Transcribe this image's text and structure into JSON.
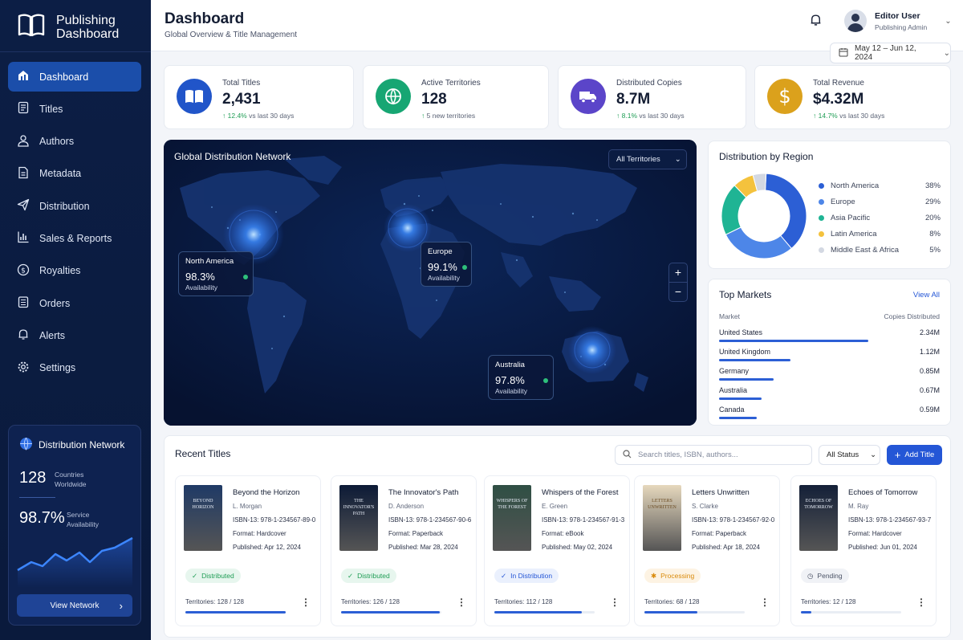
{
  "brand": {
    "line1": "Publishing",
    "line2": "Dashboard"
  },
  "nav": [
    {
      "label": "Dashboard",
      "icon": "dashboard-icon",
      "active": true
    },
    {
      "label": "Titles",
      "icon": "titles-icon"
    },
    {
      "label": "Authors",
      "icon": "user-icon"
    },
    {
      "label": "Metadata",
      "icon": "document-icon"
    },
    {
      "label": "Distribution",
      "icon": "send-icon"
    },
    {
      "label": "Sales & Reports",
      "icon": "bar-chart-icon"
    },
    {
      "label": "Royalties",
      "icon": "dollar-icon"
    },
    {
      "label": "Orders",
      "icon": "orders-icon"
    },
    {
      "label": "Alerts",
      "icon": "bell-icon"
    },
    {
      "label": "Settings",
      "icon": "gear-icon"
    }
  ],
  "network_card": {
    "title": "Distribution Network",
    "countries": "128",
    "countries_label1": "Countries",
    "countries_label2": "Worldwide",
    "availability": "98.7%",
    "availability_label1": "Service",
    "availability_label2": "Availability",
    "button": "View Network"
  },
  "header": {
    "title": "Dashboard",
    "subtitle": "Global Overview & Title Management",
    "user_name": "Editor User",
    "user_role": "Publishing Admin",
    "date_range": "May 12 – Jun 12, 2024"
  },
  "stats": [
    {
      "label": "Total Titles",
      "value": "2,431",
      "change": "12.4%",
      "change_text": "vs last 30 days",
      "color": "#2155c9"
    },
    {
      "label": "Active Territories",
      "value": "128",
      "change": "",
      "change_text": "5 new territories",
      "color": "#17a673"
    },
    {
      "label": "Distributed Copies",
      "value": "8.7M",
      "change": "8.1%",
      "change_text": "vs last 30 days",
      "color": "#5b45c9"
    },
    {
      "label": "Total Revenue",
      "value": "$4.32M",
      "change": "14.7%",
      "change_text": "vs last 30 days",
      "color": "#dba11c"
    }
  ],
  "map": {
    "title": "Global Distribution Network",
    "filter": "All Territories",
    "regions": [
      {
        "name": "North America",
        "pct": "98.3%",
        "label": "Availability"
      },
      {
        "name": "Europe",
        "pct": "99.1%",
        "label": "Availability"
      },
      {
        "name": "Australia",
        "pct": "97.8%",
        "label": "Availability"
      }
    ]
  },
  "region_chart": {
    "title": "Distribution by Region"
  },
  "chart_data": {
    "type": "pie",
    "donut": true,
    "title": "Distribution by Region",
    "categories": [
      "North America",
      "Europe",
      "Asia Pacific",
      "Latin America",
      "Middle East & Africa"
    ],
    "values": [
      38,
      29,
      20,
      8,
      5
    ],
    "labels": [
      "38%",
      "29%",
      "20%",
      "8%",
      "5%"
    ],
    "colors": [
      "#2c5fd5",
      "#4d86e8",
      "#1fb494",
      "#f4c23d",
      "#d3d8e2"
    ],
    "legend": "right"
  },
  "top_markets": {
    "title": "Top Markets",
    "view_all": "View All",
    "col1": "Market",
    "col2": "Copies Distributed",
    "rows": [
      {
        "name": "United States",
        "value": "2.34M",
        "num": 2.34
      },
      {
        "name": "United Kingdom",
        "value": "1.12M",
        "num": 1.12
      },
      {
        "name": "Germany",
        "value": "0.85M",
        "num": 0.85
      },
      {
        "name": "Australia",
        "value": "0.67M",
        "num": 0.67
      },
      {
        "name": "Canada",
        "value": "0.59M",
        "num": 0.59
      }
    ]
  },
  "recent": {
    "title": "Recent Titles",
    "search_placeholder": "Search titles, ISBN, authors...",
    "status_filter": "All Status",
    "add_button": "Add Title",
    "territories_label": "Territories:",
    "titles": [
      {
        "title": "Beyond the Horizon",
        "author": "L. Morgan",
        "isbn_label": "ISBN-13:",
        "isbn": "978-1-234567-89-0",
        "format_label": "Format:",
        "format": "Hardcover",
        "published_label": "Published:",
        "published": "Apr 12, 2024",
        "status": "Distributed",
        "status_color": "#1f9d55",
        "status_bg": "#e7f6ee",
        "territories": "128 / 128",
        "progress": 1.0,
        "cover_text": "BEYOND HORIZON",
        "cover_color": "#1f3a66"
      },
      {
        "title": "The Innovator's Path",
        "author": "D. Anderson",
        "isbn_label": "ISBN-13:",
        "isbn": "978-1-234567-90-6",
        "format_label": "Format:",
        "format": "Paperback",
        "published_label": "Published:",
        "published": "Mar 28, 2024",
        "status": "Distributed",
        "status_color": "#1f9d55",
        "status_bg": "#e7f6ee",
        "territories": "126 / 128",
        "progress": 0.98,
        "cover_text": "THE INNOVATOR'S PATH",
        "cover_color": "#0c1a36"
      },
      {
        "title": "Whispers of the Forest",
        "author": "E. Green",
        "isbn_label": "ISBN-13:",
        "isbn": "978-1-234567-91-3",
        "format_label": "Format:",
        "format": "eBook",
        "published_label": "Published:",
        "published": "May 02, 2024",
        "status": "In Distribution",
        "status_color": "#2456d6",
        "status_bg": "#eaf0fd",
        "territories": "112 / 128",
        "progress": 0.875,
        "cover_text": "WHISPERS OF THE FOREST",
        "cover_color": "#2f4f44"
      },
      {
        "title": "Letters Unwritten",
        "author": "S. Clarke",
        "isbn_label": "ISBN-13:",
        "isbn": "978-1-234567-92-0",
        "format_label": "Format:",
        "format": "Paperback",
        "published_label": "Published:",
        "published": "Apr 18, 2024",
        "status": "Processing",
        "status_color": "#d98a0b",
        "status_bg": "#fdf3e3",
        "territories": "68 / 128",
        "progress": 0.53,
        "cover_text": "LETTERS UNWRITTEN",
        "cover_color": "#e6d8bd"
      },
      {
        "title": "Echoes of Tomorrow",
        "author": "M. Ray",
        "isbn_label": "ISBN-13:",
        "isbn": "978-1-234567-93-7",
        "format_label": "Format:",
        "format": "Hardcover",
        "published_label": "Published:",
        "published": "Jun 01, 2024",
        "status": "Pending",
        "status_color": "#4b5366",
        "status_bg": "#f0f2f6",
        "territories": "12 / 128",
        "progress": 0.1,
        "cover_text": "ECHOES OF TOMORROW",
        "cover_color": "#142038"
      }
    ]
  }
}
